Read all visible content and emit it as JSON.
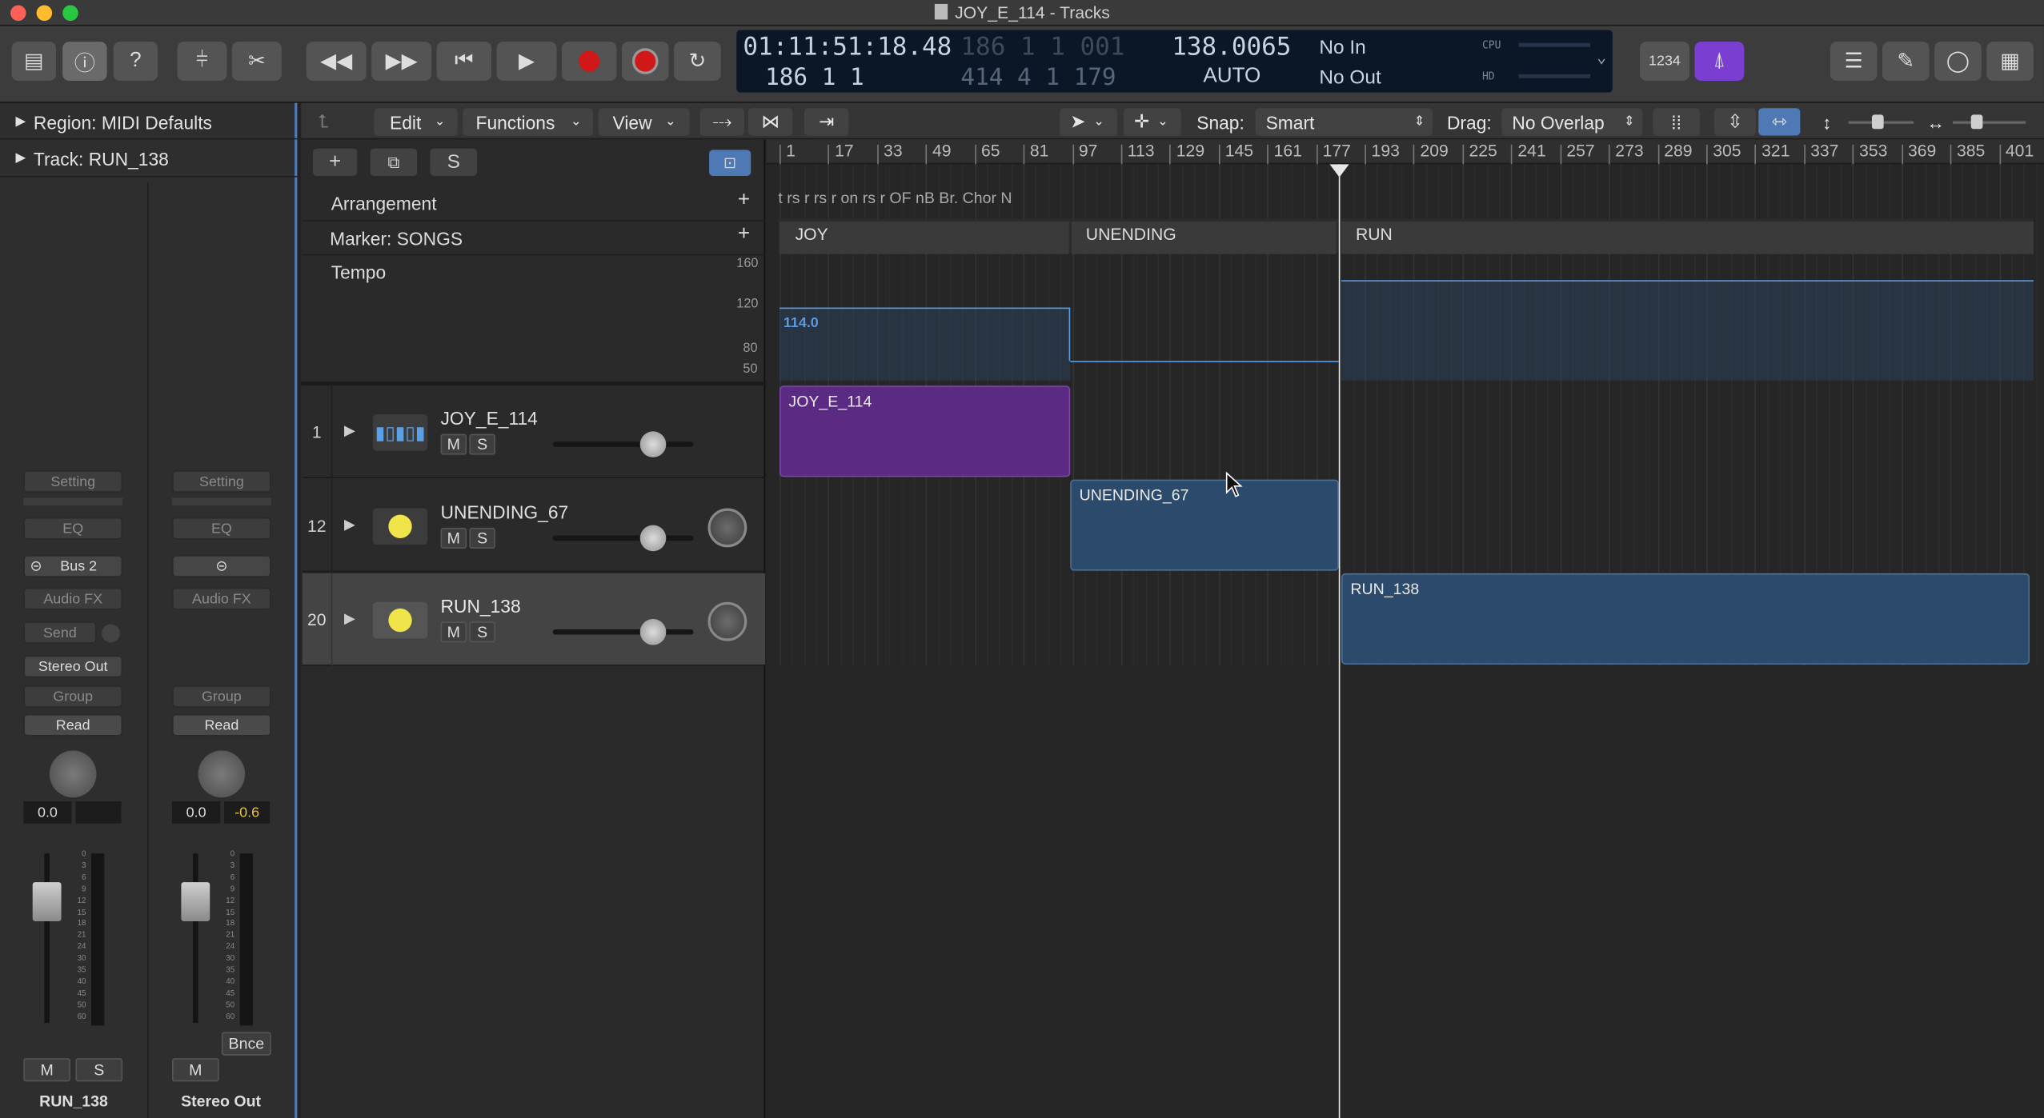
{
  "window": {
    "title": "JOY_E_114 - Tracks"
  },
  "lcd": {
    "time": "01:11:51:18.48",
    "bars": "186  1  1",
    "bars2": "414  4  1  179",
    "bars_dim": "186  1  1  001",
    "tempo": "138.0065",
    "mode": "AUTO",
    "in": "No In",
    "out": "No Out",
    "cpu": "CPU",
    "hd": "HD"
  },
  "toolbar": {
    "count_in": "1234"
  },
  "inspector": {
    "region_label": "Region:",
    "region_value": "MIDI Defaults",
    "track_label": "Track:",
    "track_value": "RUN_138"
  },
  "strip1": {
    "setting": "Setting",
    "eq": "EQ",
    "bus": "Bus 2",
    "fx": "Audio FX",
    "send": "Send",
    "output": "Stereo Out",
    "group": "Group",
    "auto": "Read",
    "vol": "0.0",
    "m": "M",
    "s": "S",
    "name": "RUN_138"
  },
  "strip2": {
    "setting": "Setting",
    "eq": "EQ",
    "fx": "Audio FX",
    "group": "Group",
    "auto": "Read",
    "vol": "0.0",
    "peak": "-0.6",
    "bnce": "Bnce",
    "m": "M",
    "name": "Stereo Out"
  },
  "meter_scale": [
    "0",
    "3",
    "6",
    "9",
    "12",
    "15",
    "18",
    "21",
    "24",
    "30",
    "35",
    "40",
    "45",
    "50",
    "60"
  ],
  "menubar": {
    "edit": "Edit",
    "functions": "Functions",
    "view": "View",
    "snap_label": "Snap:",
    "snap_value": "Smart",
    "drag_label": "Drag:",
    "drag_value": "No Overlap"
  },
  "global": {
    "arrangement": "Arrangement",
    "marker": "Marker: SONGS",
    "tempo": "Tempo",
    "t160": "160",
    "t120": "120",
    "t80": "80",
    "t50": "50",
    "tempo_value": "114.0"
  },
  "ruler": [
    "1",
    "17",
    "33",
    "49",
    "65",
    "81",
    "97",
    "113",
    "129",
    "145",
    "161",
    "177",
    "193",
    "209",
    "225",
    "241",
    "257",
    "273",
    "289",
    "305",
    "321",
    "337",
    "353",
    "369",
    "385",
    "401"
  ],
  "arr_text": "t rs  r rs  r on rs  r  OF nB  Br. Chor N",
  "markers": [
    "JOY",
    "UNENDING",
    "RUN"
  ],
  "tracks": [
    {
      "num": "1",
      "name": "JOY_E_114",
      "m": "M",
      "s": "S"
    },
    {
      "num": "12",
      "name": "UNENDING_67",
      "m": "M",
      "s": "S"
    },
    {
      "num": "20",
      "name": "RUN_138",
      "m": "M",
      "s": "S"
    }
  ],
  "regions": [
    "JOY_E_114",
    "UNENDING_67",
    "RUN_138"
  ],
  "colors": {
    "purple": "#5b2a82",
    "blue": "#2c4a6b",
    "accent": "#4f79b5"
  }
}
